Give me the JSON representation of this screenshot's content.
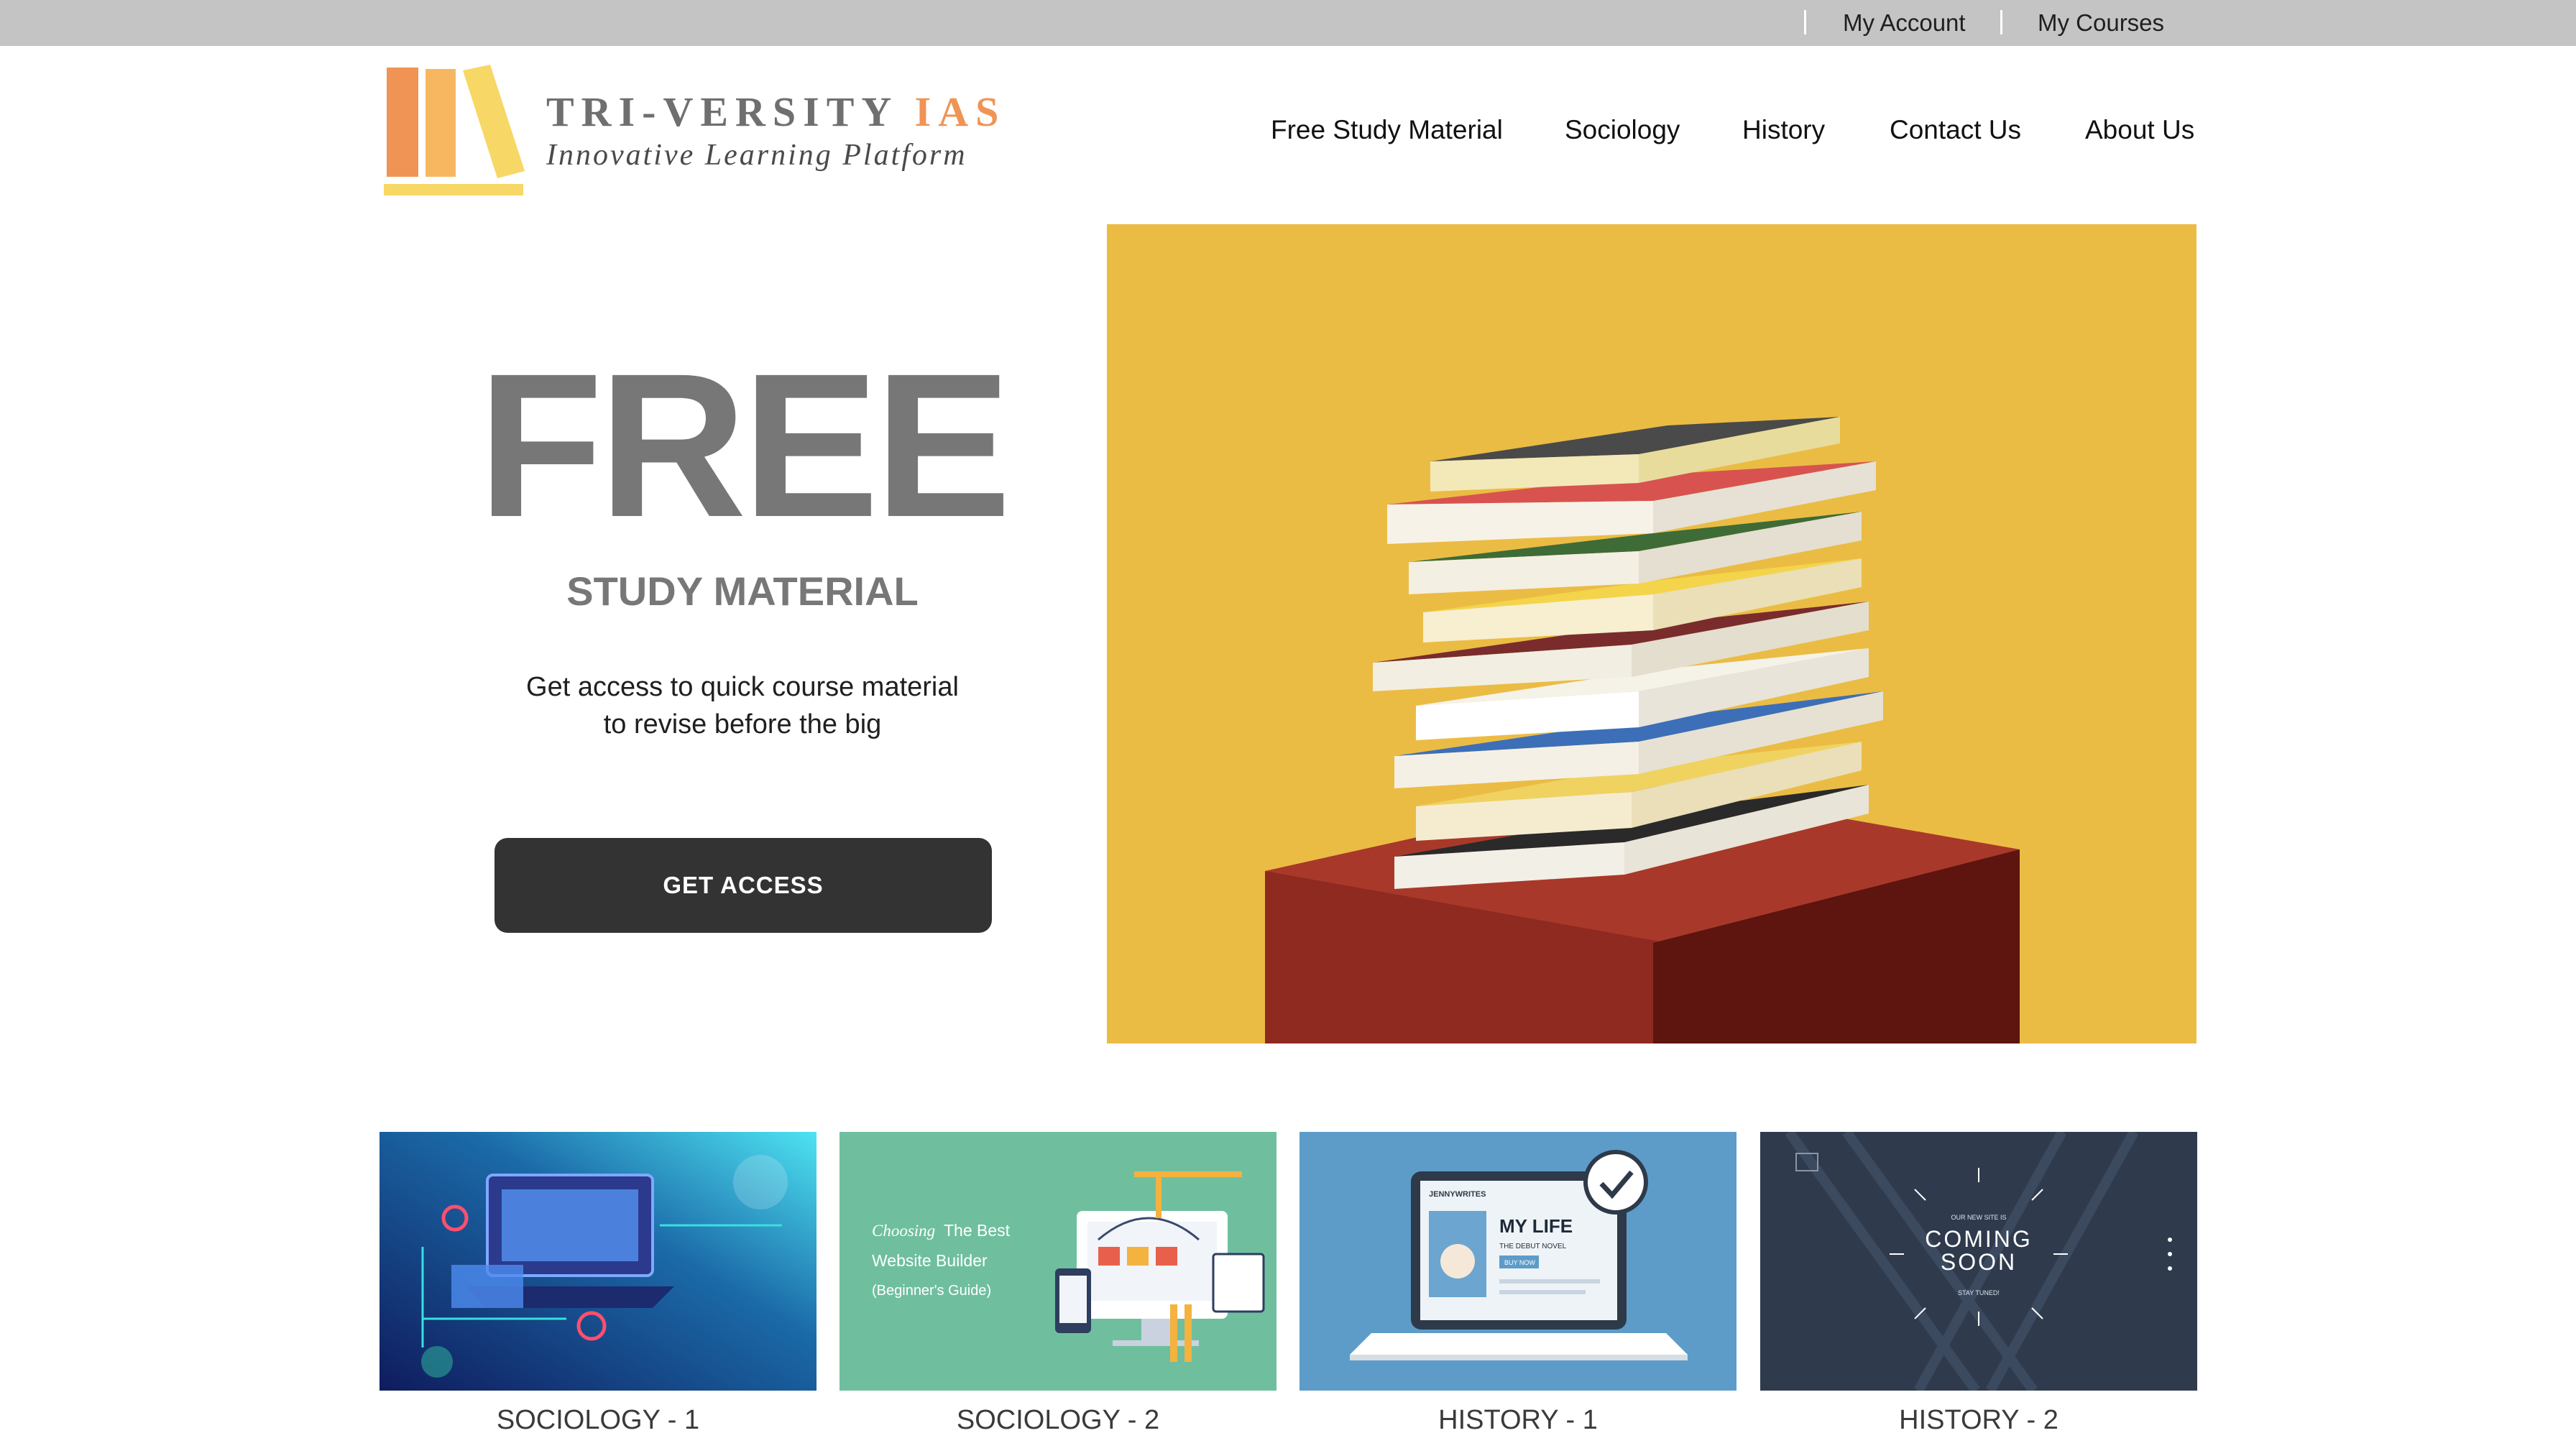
{
  "topbar": {
    "my_account": "My Account",
    "my_courses": "My Courses"
  },
  "logo": {
    "name_main": "TRI-VERSITY ",
    "name_accent": "IAS",
    "tagline": "Innovative Learning Platform"
  },
  "nav": {
    "items": [
      "Free Study Material",
      "Sociology",
      "History",
      "Contact Us",
      "About Us"
    ]
  },
  "hero": {
    "title": "FREE",
    "subtitle": "STUDY MATERIAL",
    "desc_line1": "Get access to quick course material",
    "desc_line2": "to revise before the big",
    "cta": "GET ACCESS"
  },
  "cards": [
    {
      "label": "SOCIOLOGY - 1"
    },
    {
      "label": "SOCIOLOGY - 2",
      "image_text": [
        "Choosing",
        "The Best",
        "Website Builder",
        "(Beginner's Guide)"
      ]
    },
    {
      "label": "HISTORY - 1",
      "image_text": [
        "JENNYWRITES",
        "MY LIFE",
        "THE DEBUT NOVEL",
        "BUY NOW"
      ]
    },
    {
      "label": "HISTORY - 2",
      "image_text": [
        "OUR NEW SITE IS",
        "COMING",
        "SOON",
        "STAY TUNED!"
      ]
    }
  ],
  "colors": {
    "topbar": "#c4c4c4",
    "hero_bg": "#ebbc44",
    "cta_bg": "#333333",
    "logo_accent": "#ef9455"
  }
}
